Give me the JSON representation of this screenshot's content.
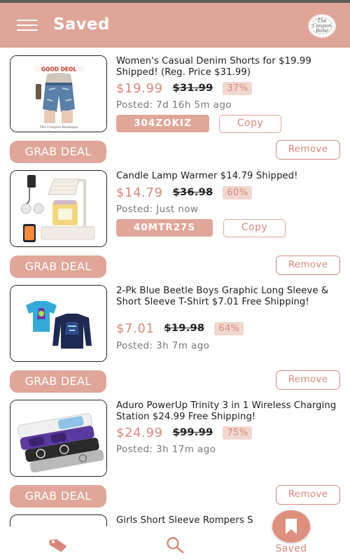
{
  "header": {
    "title": "Saved",
    "menu_icon": "hamburger-menu-icon",
    "logo_text": "The Coupon Babe"
  },
  "deals": [
    {
      "title": "Women's Casual Denim Shorts for $19.99 Shipped! (Reg. Price $31.99)",
      "price": "$19.99",
      "old_price": "$31.99",
      "discount": "37%",
      "posted": "Posted: 7d 16h 5m ago",
      "code": "304ZOKIZ",
      "copy_label": "Copy",
      "grab_label": "GRAB DEAL",
      "remove_label": "Remove",
      "image": {
        "banner": "GOOD DEOL",
        "caption": "The Coupon Boutique"
      }
    },
    {
      "title": "Candle Lamp Warmer $14.79 Shipped!",
      "price": "$14.79",
      "old_price": "$36.98",
      "discount": "60%",
      "posted": "Posted: Just now",
      "code": "40MTR27S",
      "copy_label": "Copy",
      "grab_label": "GRAB DEAL",
      "remove_label": "Remove"
    },
    {
      "title": "2-Pk Blue Beetle Boys Graphic Long Sleeve & Short Sleeve T-Shirt $7.01 Free Shipping!",
      "price": "$7.01",
      "old_price": "$19.98",
      "discount": "64%",
      "posted": "Posted: 3h 7m ago",
      "grab_label": "GRAB DEAL",
      "remove_label": "Remove"
    },
    {
      "title": "Aduro PowerUp Trinity 3 in 1 Wireless Charging Station $24.99 Free Shipping!",
      "price": "$24.99",
      "old_price": "$99.99",
      "discount": "75%",
      "posted": "Posted: 3h 17m ago",
      "grab_label": "GRAB DEAL",
      "remove_label": "Remove"
    },
    {
      "title": "Girls Short Sleeve Rompers S"
    }
  ],
  "bottom_nav": {
    "deals_icon": "price-tag-icon",
    "search_icon": "search-icon",
    "saved_icon": "bookmark-icon",
    "saved_label": "Saved"
  },
  "colors": {
    "accent": "#e0a699",
    "price": "#d7897a",
    "header": "#dfa598",
    "discount_bg": "#f2d6d0"
  }
}
